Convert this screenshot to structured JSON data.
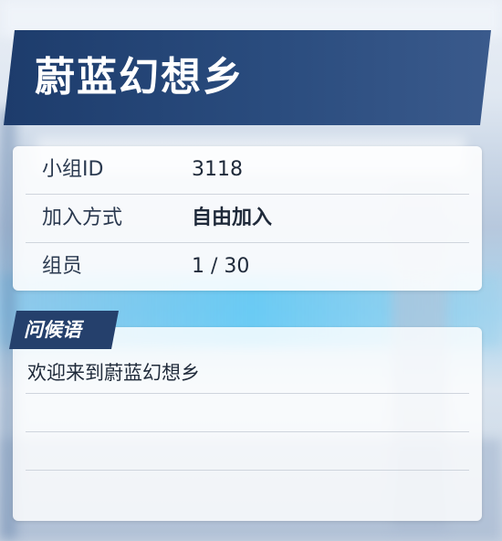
{
  "header": {
    "title": "蔚蓝幻想乡"
  },
  "info": {
    "rows": [
      {
        "label": "小组ID",
        "value": "3118"
      },
      {
        "label": "加入方式",
        "value": "自由加入"
      },
      {
        "label": "组员",
        "value": "1 / 30"
      }
    ]
  },
  "greeting": {
    "tag": "问候语",
    "text": "欢迎来到蔚蓝幻想乡"
  },
  "colors": {
    "banner": "#1d3c6c",
    "tag": "#25406c",
    "text": "#1f2a3a"
  }
}
